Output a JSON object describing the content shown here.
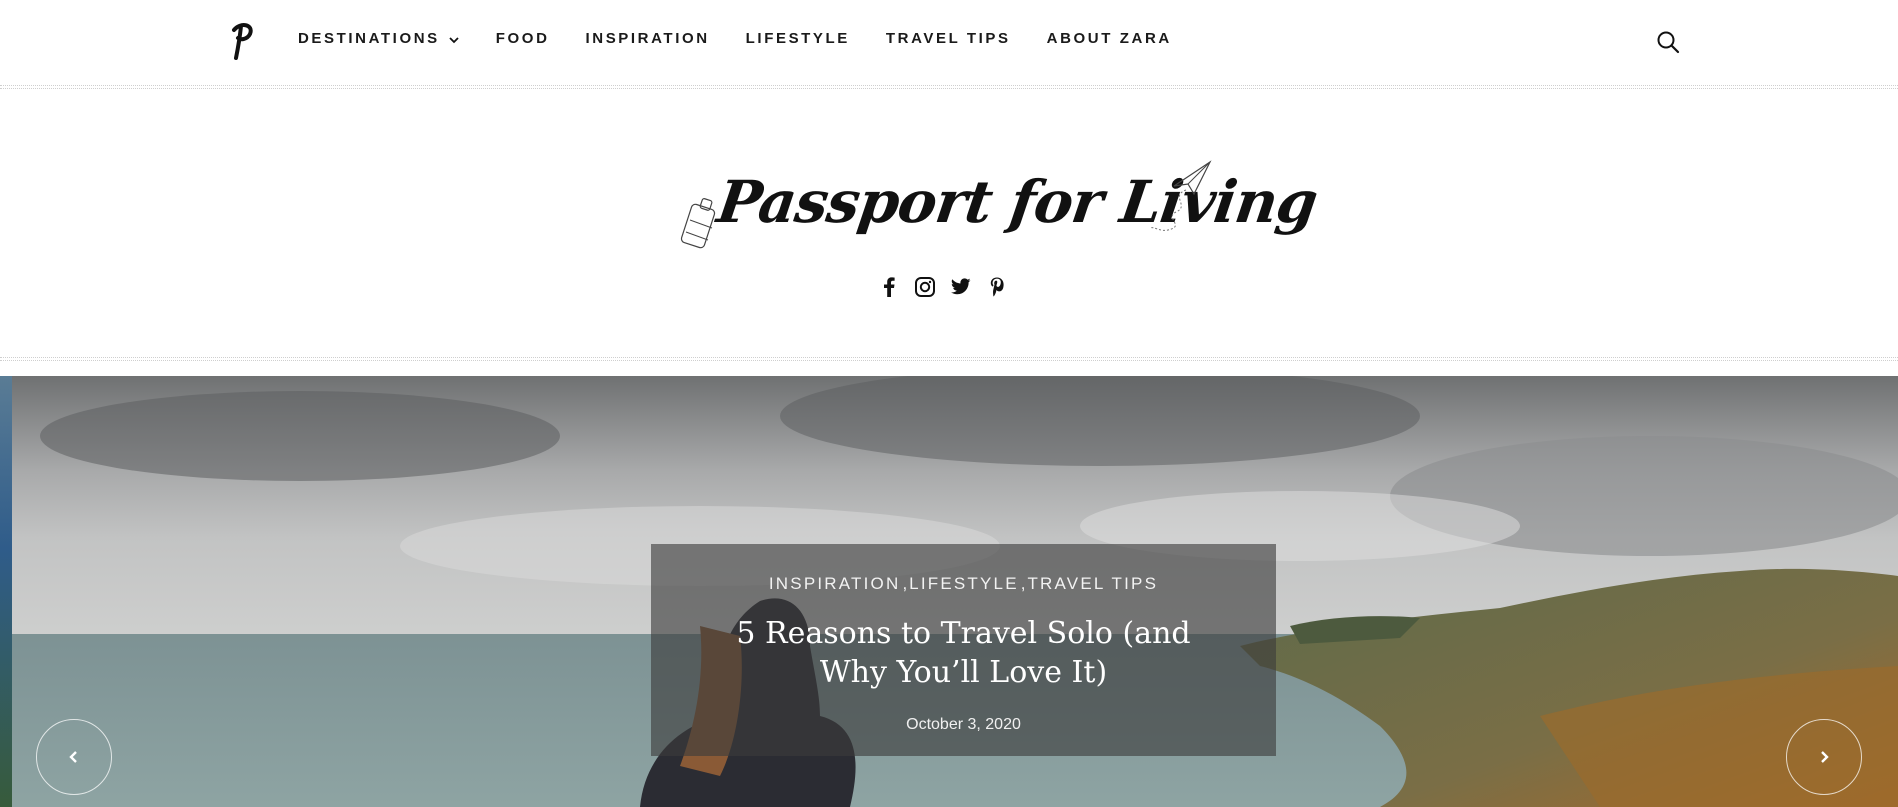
{
  "nav": {
    "logo_letter": "P",
    "items": [
      {
        "label": "DESTINATIONS",
        "has_dropdown": true
      },
      {
        "label": "FOOD"
      },
      {
        "label": "INSPIRATION"
      },
      {
        "label": "LIFESTYLE"
      },
      {
        "label": "TRAVEL TIPS"
      },
      {
        "label": "ABOUT ZARA"
      }
    ],
    "search_icon": "search-icon"
  },
  "brand": {
    "title": "Passport for Living",
    "icons": [
      "suitcase-icon",
      "paper-plane-icon"
    ]
  },
  "social": [
    "facebook-icon",
    "instagram-icon",
    "twitter-icon",
    "pinterest-icon"
  ],
  "hero": {
    "categories": [
      "INSPIRATION",
      "LIFESTYLE",
      "TRAVEL TIPS"
    ],
    "title": "5 Reasons to Travel Solo (and Why You’ll Love It)",
    "date": "October 3, 2020",
    "prev_icon": "chevron-left-icon",
    "next_icon": "chevron-right-icon"
  },
  "colors": {
    "text": "#1a1a1a",
    "caption_bg": "rgba(60,60,60,0.62)",
    "caption_text": "#ffffff"
  }
}
